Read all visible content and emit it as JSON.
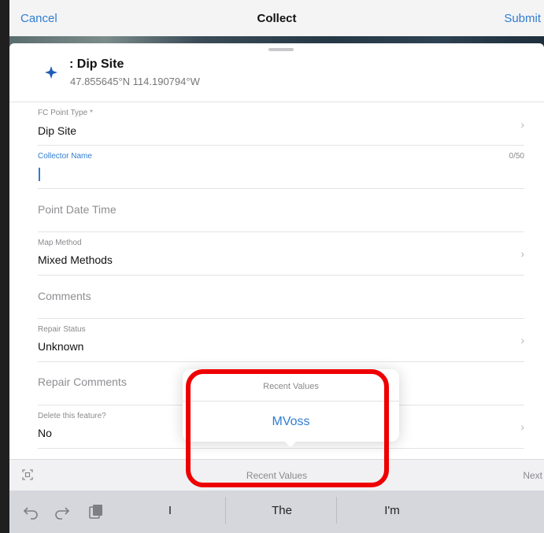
{
  "navbar": {
    "cancel": "Cancel",
    "title": "Collect",
    "submit": "Submit"
  },
  "header": {
    "title": ": Dip Site",
    "coordinates": "47.855645°N 114.190794°W",
    "icon": "crosshair-point-icon"
  },
  "form": {
    "fields": [
      {
        "label": "FC Point Type *",
        "value": "Dip Site",
        "has_chevron": true
      },
      {
        "label": "Collector Name",
        "value": "",
        "counter": "0/50",
        "focused": true
      },
      {
        "placeholder": "Point Date Time"
      },
      {
        "label": "Map Method",
        "value": "Mixed Methods",
        "has_chevron": true
      },
      {
        "placeholder": "Comments"
      },
      {
        "label": "Repair Status",
        "value": "Unknown",
        "has_chevron": true
      },
      {
        "placeholder": "Repair Comments"
      },
      {
        "label": "Delete this feature?",
        "value": "No",
        "has_chevron": true
      }
    ]
  },
  "popover": {
    "title": "Recent Values",
    "items": [
      "MVoss"
    ]
  },
  "accessory": {
    "title": "Recent Values",
    "next": "Next"
  },
  "keyboard": {
    "suggestions": [
      "I",
      "The",
      "I'm"
    ]
  },
  "colors": {
    "accent": "#2f7dd0",
    "annotation": "#ee0000"
  }
}
